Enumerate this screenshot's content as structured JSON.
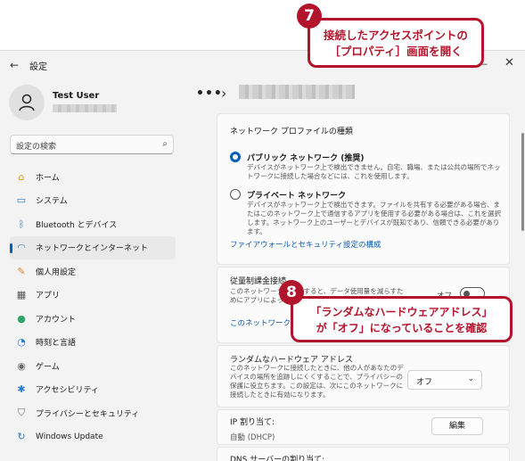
{
  "window": {
    "title": "設定",
    "user_name": "Test User",
    "search_placeholder": "設定の検索",
    "back_glyph": "←",
    "min_glyph": "—",
    "close_glyph": "✕"
  },
  "breadcrumb": {
    "dots": "•••",
    "sep": "›"
  },
  "nav": [
    {
      "label": "ホーム",
      "icon": "home-icon",
      "glyph": "⌂",
      "color": "#e69b1e"
    },
    {
      "label": "システム",
      "icon": "system-icon",
      "glyph": "▭",
      "color": "#2b7cd3"
    },
    {
      "label": "Bluetooth とデバイス",
      "icon": "bluetooth-icon",
      "glyph": "ᛒ",
      "color": "#2b7cd3"
    },
    {
      "label": "ネットワークとインターネット",
      "icon": "wifi-icon",
      "glyph": "◠",
      "color": "#3a7bd5",
      "selected": true
    },
    {
      "label": "個人用設定",
      "icon": "paint-brush-icon",
      "glyph": "✎",
      "color": "#d9822b"
    },
    {
      "label": "アプリ",
      "icon": "apps-icon",
      "glyph": "▦",
      "color": "#555555"
    },
    {
      "label": "アカウント",
      "icon": "account-icon",
      "glyph": "●",
      "color": "#2fa36b"
    },
    {
      "label": "時刻と言語",
      "icon": "time-language-icon",
      "glyph": "◔",
      "color": "#2b7cd3"
    },
    {
      "label": "ゲーム",
      "icon": "game-icon",
      "glyph": "◉",
      "color": "#6a6a6a"
    },
    {
      "label": "アクセシビリティ",
      "icon": "accessibility-icon",
      "glyph": "✱",
      "color": "#2b7cd3"
    },
    {
      "label": "プライバシーとセキュリティ",
      "icon": "shield-icon",
      "glyph": "⛉",
      "color": "#6a6a6a"
    },
    {
      "label": "Windows Update",
      "icon": "update-icon",
      "glyph": "↻",
      "color": "#2b7cd3"
    }
  ],
  "profile": {
    "title": "ネットワーク プロファイルの種類",
    "public_label": "パブリック ネットワーク (推奨)",
    "public_desc": "デバイスがネットワーク上で検出できません。自宅、職場、または公共の場所でネットワークに接続した場合などには、これを使用します。",
    "private_label": "プライベート ネットワーク",
    "private_desc": "デバイスがネットワーク上で検出できます。ファイルを共有する必要がある場合、またはこのネットワーク上で通信するアプリを使用する必要がある場合は、これを選択します。ネットワーク上のユーザーとデバイスが既知であり、信頼できる必要があります。",
    "firewall_link": "ファイアウォールとセキュリティ設定の構成"
  },
  "metered": {
    "title": "従量制課金接続",
    "desc": "このネットワークに接続すると、データ使用量を減らすためにアプリによっては異なる動作をする場合があります",
    "toggle_label": "オフ",
    "link": "このネットワーク上のデータ使用量の上限を設定する"
  },
  "random_hw": {
    "title": "ランダムなハードウェア アドレス",
    "desc": "このネットワークに接続したときに、他の人があなたのデバイスの場所を追跡しにくくすることで、プライバシーの保護に役立ちます。この設定は、次にこのネットワークに接続したときに有効になります。",
    "value": "オフ"
  },
  "ip": {
    "title": "IP 割り当て:",
    "value": "自動 (DHCP)",
    "edit": "編集"
  },
  "dns": {
    "title": "DNS サーバーの割り当て:"
  },
  "callouts": {
    "c7_num": "7",
    "c7_line1": "接続したアクセスポイントの",
    "c7_line2": "［プロパティ］画面を開く",
    "c8_num": "8",
    "c8_line1": "「ランダムなハードウェアアドレス」",
    "c8_line2": "が「オフ」になっていることを確認"
  }
}
